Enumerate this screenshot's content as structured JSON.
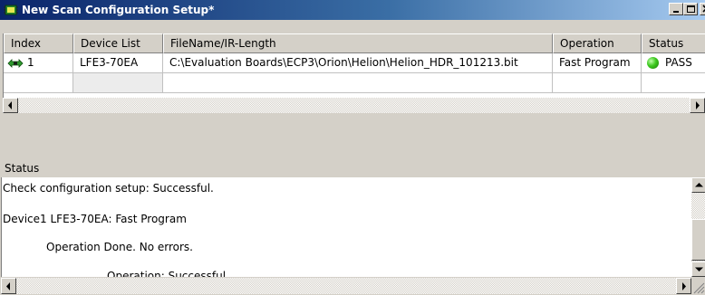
{
  "window": {
    "title": "New Scan Configuration Setup*",
    "titlebar_colors": [
      "#0a246a",
      "#a6caf0"
    ]
  },
  "grid": {
    "columns": [
      "Index",
      "Device List",
      "FileName/IR-Length",
      "Operation",
      "Status"
    ],
    "rows": [
      {
        "index": "1",
        "device": "LFE3-70EA",
        "file": "C:\\Evaluation Boards\\ECP3\\Orion\\Helion\\Helion_HDR_101213.bit",
        "operation": "Fast Program",
        "status": "PASS",
        "status_icon": "green-status-dot-icon",
        "status_color": "#3cc81e"
      }
    ]
  },
  "status_panel": {
    "title": "Status",
    "log_lines": [
      "Check configuration setup: Successful.",
      "Device1 LFE3-70EA: Fast Program",
      "Operation Done. No errors.",
      "Operation: Successful."
    ]
  }
}
